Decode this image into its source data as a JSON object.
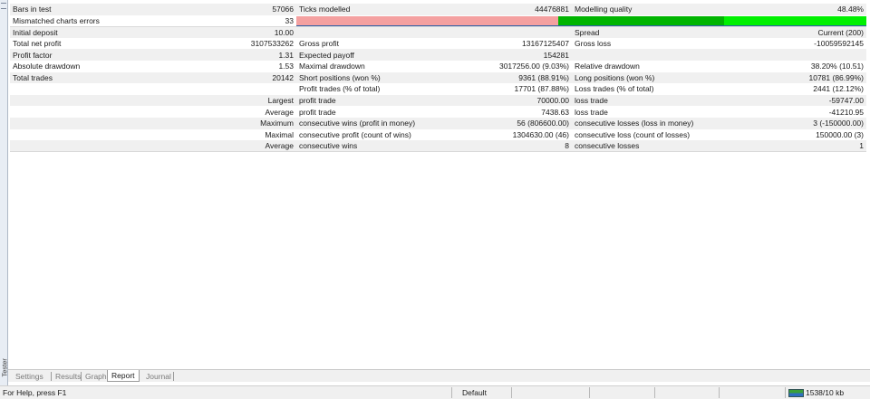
{
  "side_panel": {
    "label": "Tester"
  },
  "report": {
    "rows": [
      [
        "Bars in test",
        "57066",
        "Ticks modelled",
        "44476881",
        "Modelling quality",
        "48.48%"
      ],
      [
        "Mismatched charts errors",
        "33",
        "",
        "",
        "",
        ""
      ],
      [
        "Initial deposit",
        "10.00",
        "",
        "",
        "Spread",
        "Current (200)"
      ],
      [
        "Total net profit",
        "3107533262",
        "Gross profit",
        "13167125407",
        "Gross loss",
        "-10059592145"
      ],
      [
        "Profit factor",
        "1.31",
        "Expected payoff",
        "154281",
        "",
        ""
      ],
      [
        "Absolute drawdown",
        "1.53",
        "Maximal drawdown",
        "3017256.00 (9.03%)",
        "Relative drawdown",
        "38.20% (10.51)"
      ],
      [
        "Total trades",
        "20142",
        "Short positions (won %)",
        "9361 (88.91%)",
        "Long positions (won %)",
        "10781 (86.99%)"
      ],
      [
        "",
        "",
        "Profit trades (% of total)",
        "17701 (87.88%)",
        "Loss trades (% of total)",
        "2441 (12.12%)"
      ],
      [
        "",
        "Largest",
        "profit trade",
        "70000.00",
        "loss trade",
        "-59747.00"
      ],
      [
        "",
        "Average",
        "profit trade",
        "7438.63",
        "loss trade",
        "-41210.95"
      ],
      [
        "",
        "Maximum",
        "consecutive wins (profit in money)",
        "56 (806600.00)",
        "consecutive losses (loss in money)",
        "3 (-150000.00)"
      ],
      [
        "",
        "Maximal",
        "consecutive profit (count of wins)",
        "1304630.00 (46)",
        "consecutive loss (count of losses)",
        "150000.00 (3)"
      ],
      [
        "",
        "Average",
        "consecutive wins",
        "8",
        "consecutive losses",
        "1"
      ]
    ],
    "quality_bar": {
      "color_bad": "#f4a0a0",
      "color_mid": "#00b400",
      "color_good": "#00f000",
      "segments": [
        0.46,
        0.29,
        0.25
      ]
    }
  },
  "tabs": [
    {
      "label": "Settings",
      "active": false
    },
    {
      "label": "Results",
      "active": false
    },
    {
      "label": "Graph",
      "active": false
    },
    {
      "label": "Report",
      "active": true
    },
    {
      "label": "Journal",
      "active": false
    }
  ],
  "status_bar": {
    "help_text": "For Help, press F1",
    "profile": "Default",
    "traffic": "1538/10 kb"
  }
}
